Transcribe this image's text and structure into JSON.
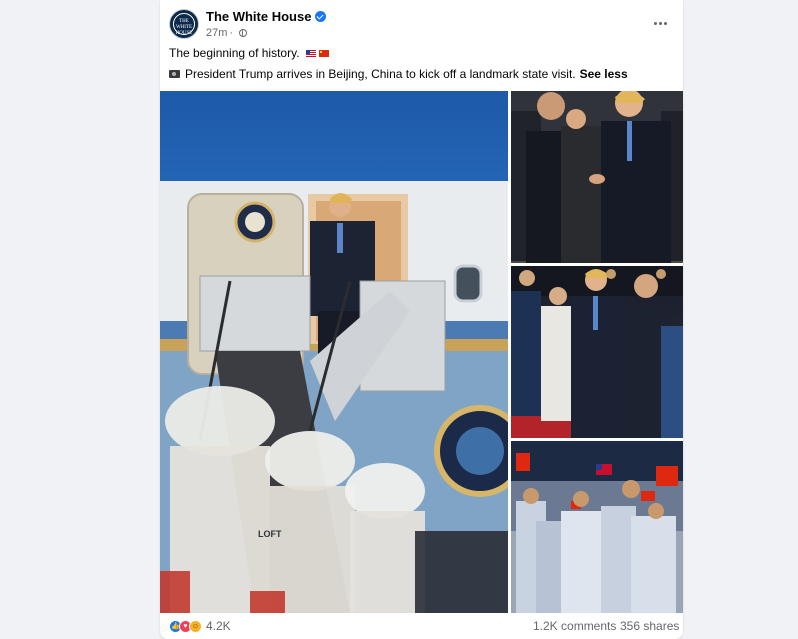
{
  "post": {
    "page_name": "The White House",
    "avatar_text": "THE WHITE HOUSE",
    "timestamp": "27m",
    "separator": "·",
    "caption_line1": "The beginning of history.",
    "caption_line2": "President Trump arrives in Beijing, China to kick off a landmark state visit.",
    "see_less": "See less"
  },
  "photos": {
    "main_stair_text": "LOFT",
    "count": 4
  },
  "footer": {
    "reaction_count": "4.2K",
    "comments": "1.2K comments",
    "shares": "356 shares"
  },
  "colors": {
    "background": "#f0f2f5",
    "card": "#ffffff",
    "verified": "#1877f2",
    "secondary_text": "#65676b",
    "like": "#1877f2",
    "love": "#f33e58",
    "haha": "#f7b125"
  },
  "icons": {
    "verified": "verified-badge-icon",
    "privacy": "globe-icon",
    "more": "more-options-icon",
    "camera": "camera-icon",
    "flag_us": "us-flag-icon",
    "flag_cn": "china-flag-icon",
    "like": "like-reaction-icon",
    "love": "love-reaction-icon",
    "haha": "haha-reaction-icon"
  }
}
